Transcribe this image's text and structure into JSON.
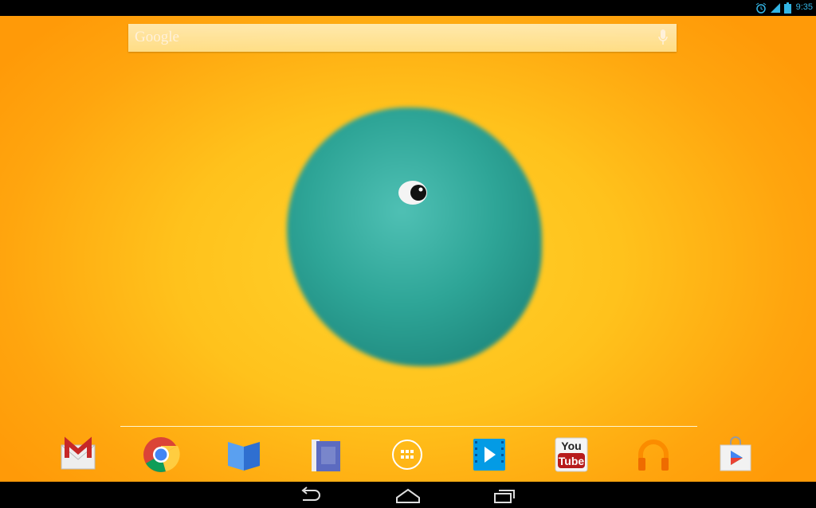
{
  "status_bar": {
    "time": "9:35",
    "icons": [
      "alarm-icon",
      "signal-icon",
      "battery-icon"
    ],
    "accent": "#33b5e5"
  },
  "search": {
    "logo": "Google",
    "mic_icon": "mic-icon"
  },
  "dock": [
    {
      "name": "Gmail",
      "icon": "gmail-icon"
    },
    {
      "name": "Chrome",
      "icon": "chrome-icon"
    },
    {
      "name": "Play Books",
      "icon": "books-icon"
    },
    {
      "name": "Play Magazines",
      "icon": "magazines-icon"
    },
    {
      "name": "All apps",
      "icon": "app-drawer-icon"
    },
    {
      "name": "Play Movies",
      "icon": "movies-icon"
    },
    {
      "name": "YouTube",
      "icon": "youtube-icon",
      "text_top": "You",
      "text_bottom": "Tube"
    },
    {
      "name": "Play Music",
      "icon": "music-icon"
    },
    {
      "name": "Play Store",
      "icon": "play-store-icon"
    }
  ],
  "nav": [
    "back",
    "home",
    "recents"
  ]
}
